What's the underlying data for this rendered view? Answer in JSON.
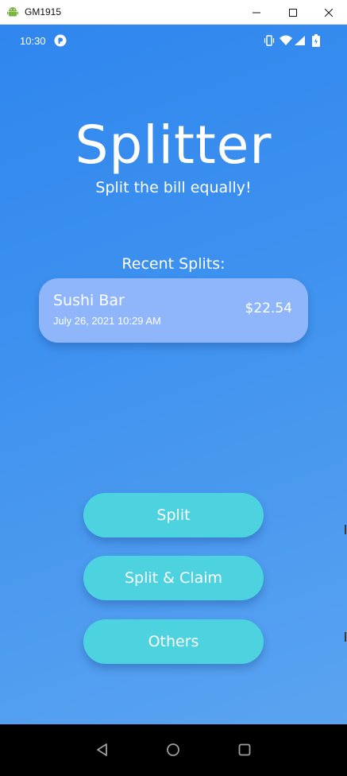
{
  "window": {
    "title": "GM1915",
    "app_icon": "android-icon",
    "controls": [
      "minimize-icon",
      "maximize-icon",
      "close-icon"
    ]
  },
  "status_bar": {
    "time": "10:30",
    "app_icon": "notification-app-icon",
    "right_icons": [
      "vibrate-icon",
      "wifi-icon",
      "signal-icon",
      "battery-icon"
    ]
  },
  "app": {
    "title": "Splitter",
    "subtitle": "Split the bill equally!"
  },
  "recent": {
    "heading": "Recent Splits:",
    "items": [
      {
        "name": "Sushi Bar",
        "date": "July 26, 2021 10:29 AM",
        "amount": "$22.54"
      }
    ]
  },
  "actions": {
    "split": "Split",
    "split_claim": "Split & Claim",
    "others": "Others"
  },
  "nav_bar": {
    "icons": [
      "back-icon",
      "home-icon",
      "recents-icon"
    ]
  },
  "colors": {
    "background_top": "#2f86ee",
    "background_bottom": "#5aa3f0",
    "card": "#8fb6fb",
    "button": "#4dd2e0"
  }
}
